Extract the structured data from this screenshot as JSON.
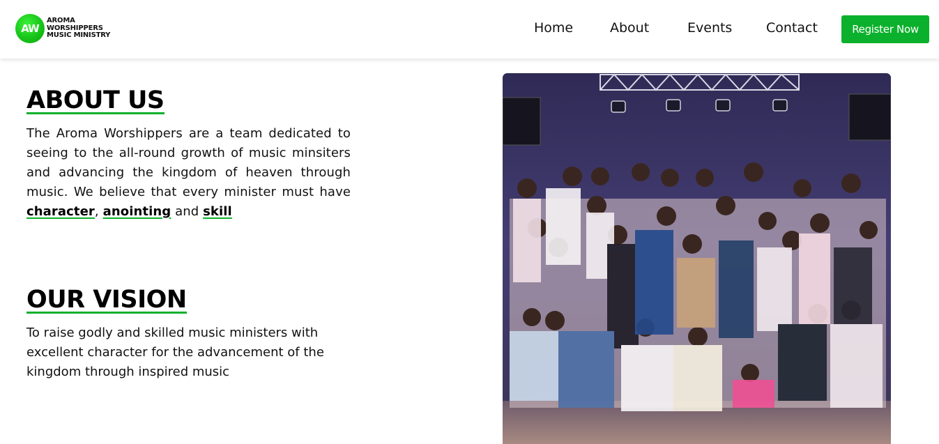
{
  "brand": {
    "logo_initials": "AW",
    "name_lines": [
      "AROMA",
      "WORSHIPPERS",
      "MUSIC MINISTRY"
    ],
    "accent_color": "#0bb12c"
  },
  "nav": {
    "home": "Home",
    "about": "About",
    "events": "Events",
    "contact": "Contact",
    "register": "Register Now"
  },
  "about": {
    "title": "ABOUT US",
    "text_lead": "The Aroma Worshippers are a team dedicated to seeing to the all-round growth of music minsiters and advancing the kingdom of heaven through music. We believe that every minister must have",
    "kw1": "character",
    "sep1": ",",
    "kw2": "anointing",
    "sep2": "and",
    "kw3": "skill"
  },
  "vision": {
    "title": "OUR VISION",
    "text": "To raise godly and skilled music ministers with excellent character for the advancement of the kingdom through inspired music"
  },
  "photo": {
    "subject": "group-photo"
  }
}
